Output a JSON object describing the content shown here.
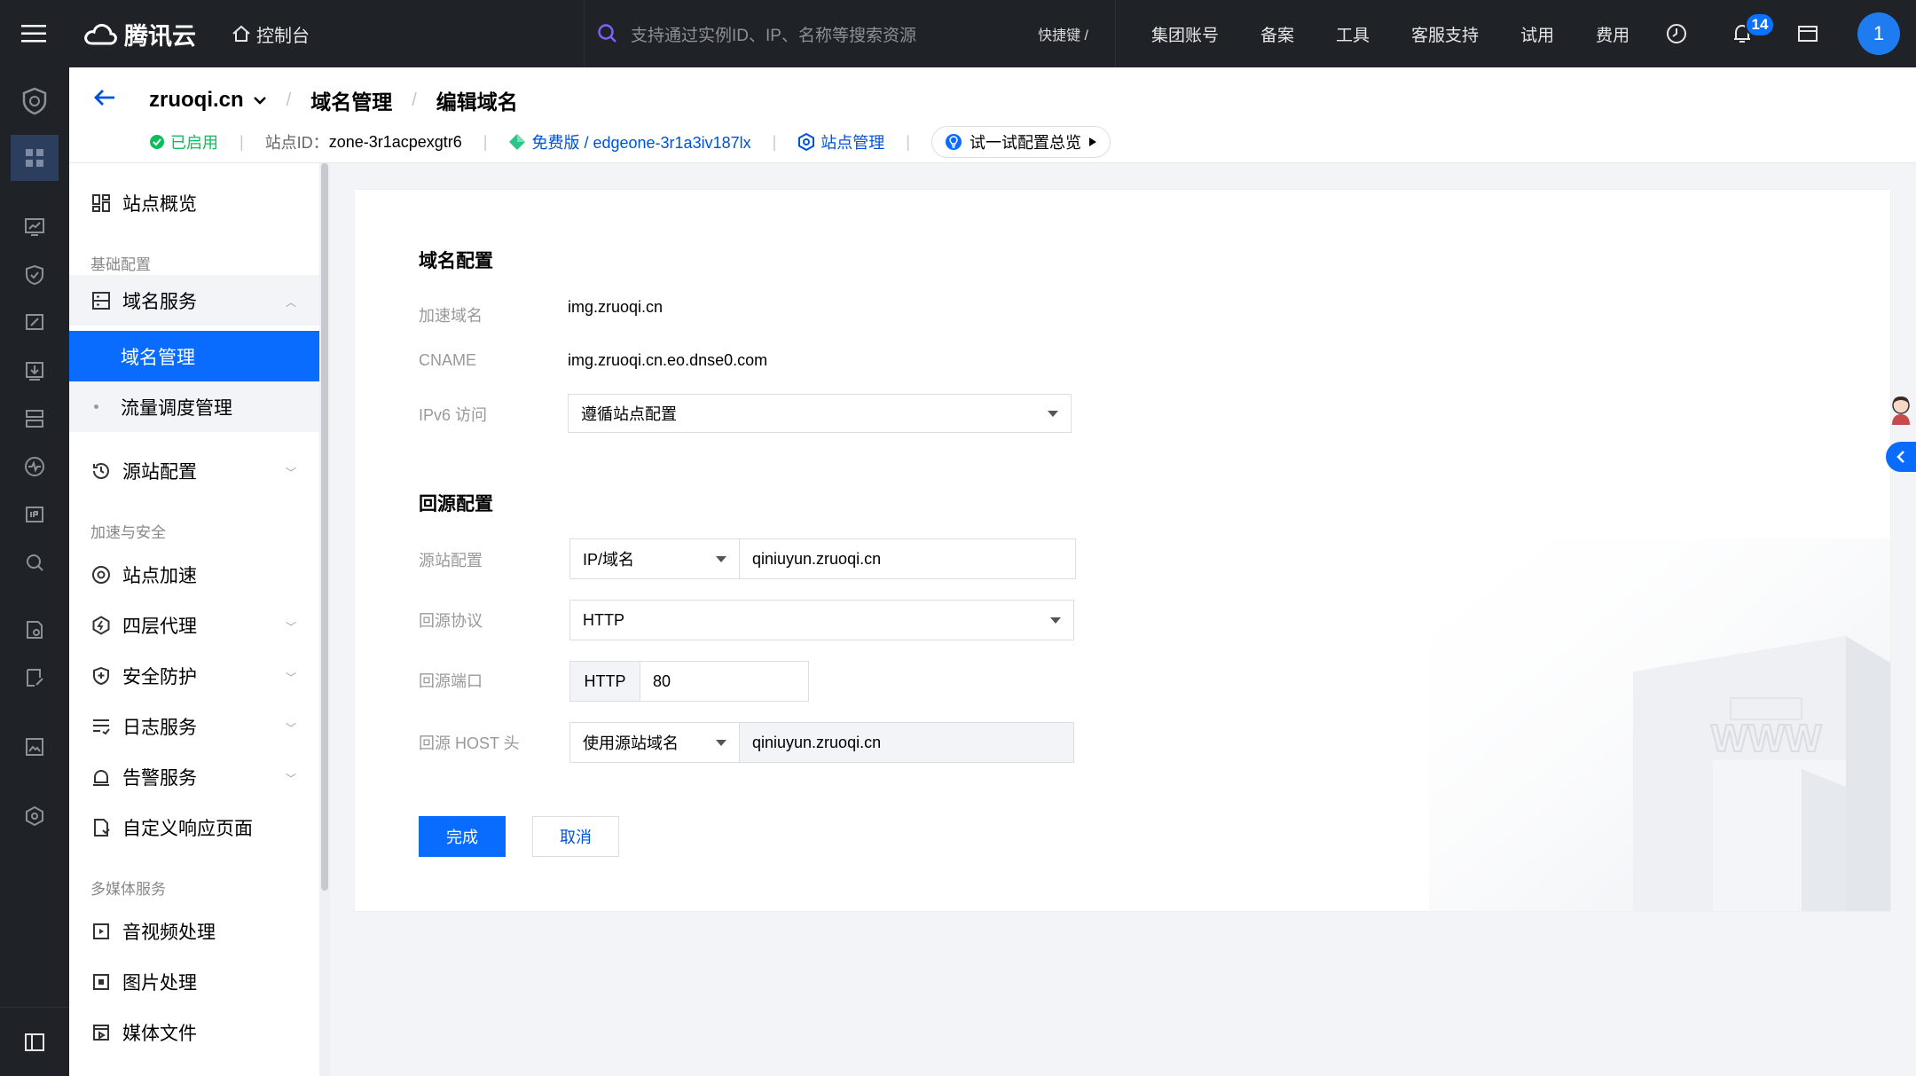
{
  "topbar": {
    "brand": "腾讯云",
    "console": "控制台",
    "search_placeholder": "支持通过实例ID、IP、名称等搜索资源",
    "shortcut": "快捷键 /",
    "nav": [
      "集团账号",
      "备案",
      "工具",
      "客服支持",
      "试用",
      "费用"
    ],
    "notification_count": "14",
    "avatar": "1"
  },
  "header": {
    "site_name": "zruoqi.cn",
    "crumb1": "域名管理",
    "crumb2": "编辑域名",
    "status": "已启用",
    "site_id_label": "站点ID：",
    "site_id": "zone-3r1acpexgtr6",
    "plan": "免费版 / edgeone-3r1a3iv187lx",
    "site_manage": "站点管理",
    "try_config": "试一试配置总览"
  },
  "sidebar": {
    "overview": "站点概览",
    "group_basic": "基础配置",
    "domain_service": "域名服务",
    "domain_manage": "域名管理",
    "traffic_schedule": "流量调度管理",
    "origin_config": "源站配置",
    "group_accel": "加速与安全",
    "site_accel": "站点加速",
    "l4_proxy": "四层代理",
    "security": "安全防护",
    "log_service": "日志服务",
    "alarm_service": "告警服务",
    "custom_page": "自定义响应页面",
    "group_media": "多媒体服务",
    "av_process": "音视频处理",
    "image_process": "图片处理",
    "media_file": "媒体文件"
  },
  "form": {
    "section_domain": "域名配置",
    "accel_domain_label": "加速域名",
    "accel_domain": "img.zruoqi.cn",
    "cname_label": "CNAME",
    "cname": "img.zruoqi.cn.eo.dnse0.com",
    "ipv6_label": "IPv6 访问",
    "ipv6_value": "遵循站点配置",
    "section_origin": "回源配置",
    "origin_label": "源站配置",
    "origin_type": "IP/域名",
    "origin_value": "qiniuyun.zruoqi.cn",
    "protocol_label": "回源协议",
    "protocol_value": "HTTP",
    "port_label": "回源端口",
    "port_addon": "HTTP",
    "port_value": "80",
    "host_label": "回源 HOST 头",
    "host_type": "使用源站域名",
    "host_value": "qiniuyun.zruoqi.cn",
    "submit": "完成",
    "cancel": "取消"
  },
  "colors": {
    "primary": "#0a6cff",
    "topbar_bg": "#1f2226",
    "success": "#0abf5b"
  }
}
